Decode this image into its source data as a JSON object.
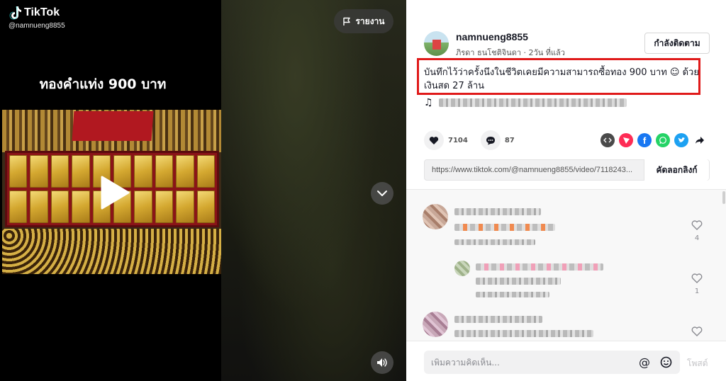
{
  "brand": {
    "name": "TikTok",
    "handle": "@namnueng8855"
  },
  "video": {
    "caption": "ทองคำแท่ง 900 บาท",
    "report_label": "รายงาน"
  },
  "author": {
    "username": "namnueng8855",
    "display_name": "ภิรดา ธนโชติจินดา",
    "posted": "2วัน ที่แล้ว",
    "follow_label": "กำลังติดตาม"
  },
  "description": "บันทึกไว้ว่าครั้งนึงในชีวิตเคยมีความสามารถซื้อทอง 900 บาท ☺ ด้วย เงินสด 27 ล้าน",
  "stats": {
    "likes": "7104",
    "comments": "87"
  },
  "share": {
    "link": "https://www.tiktok.com/@namnueng8855/video/7118243...",
    "copy_label": "คัดลอกลิงก์"
  },
  "comments": [
    {
      "likes": "4"
    },
    {
      "likes": "1"
    },
    {
      "likes": ""
    }
  ],
  "composer": {
    "placeholder": "เพิ่มความคิดเห็น...",
    "post_label": "โพสต์"
  },
  "colors": {
    "accent_red": "#e01a1a",
    "facebook": "#1877f2",
    "whatsapp": "#25d366",
    "twitter": "#1da1f2",
    "embed": "#4a4a4a",
    "send": "#fe2c55"
  }
}
